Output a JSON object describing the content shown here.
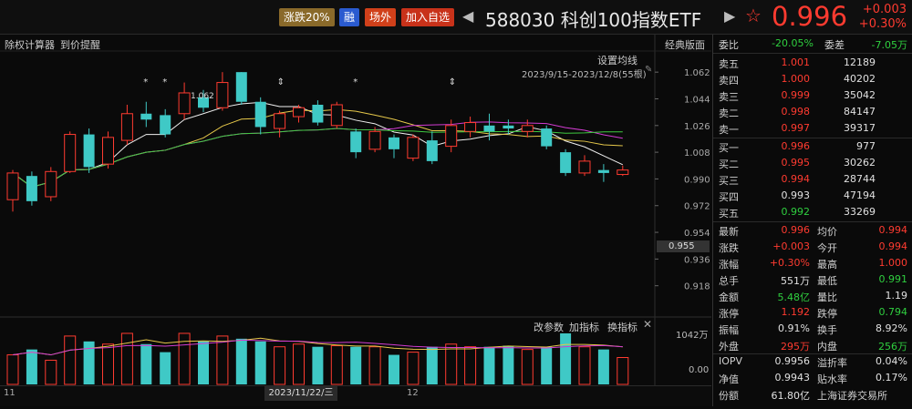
{
  "header": {
    "tag_limit": "涨跌20%",
    "tag_margin": "融",
    "tag_otc": "场外",
    "tag_watch": "加入自选",
    "title": "588030 科创100指数ETF",
    "price": "0.996",
    "change": "+0.003",
    "change_pct": "+0.30%"
  },
  "toolbar": {
    "ex_rights": "除权计算器",
    "due_remind": "到价提醒",
    "classic": "经典版面",
    "ma_setting": "设置均线",
    "range": "2023/9/15-2023/12/8(55根)",
    "vol_params": "改参数",
    "add_indicator": "加指标",
    "switch_indicator": "换指标"
  },
  "chart_data": {
    "type": "candlestick",
    "y_ticks": [
      "1.062",
      "1.044",
      "1.026",
      "1.008",
      "0.990",
      "0.972",
      "0.954",
      "0.936",
      "0.918"
    ],
    "ylim": [
      0.9,
      1.075
    ],
    "hover_price": "0.955",
    "max_label": "1.062",
    "vol_ticks": [
      "1042万",
      "0.00"
    ],
    "x_labels": [
      "11",
      "2023/11/22/三",
      "12"
    ],
    "candles": [
      {
        "o": 0.976,
        "c": 0.994,
        "h": 0.996,
        "l": 0.968
      },
      {
        "o": 0.992,
        "c": 0.975,
        "h": 0.995,
        "l": 0.972
      },
      {
        "o": 0.978,
        "c": 0.995,
        "h": 0.998,
        "l": 0.975
      },
      {
        "o": 0.995,
        "c": 1.02,
        "h": 1.022,
        "l": 0.994
      },
      {
        "o": 1.02,
        "c": 0.998,
        "h": 1.024,
        "l": 0.994
      },
      {
        "o": 1.0,
        "c": 1.018,
        "h": 1.022,
        "l": 0.997
      },
      {
        "o": 1.016,
        "c": 1.034,
        "h": 1.04,
        "l": 1.013
      },
      {
        "o": 1.034,
        "c": 1.03,
        "h": 1.042,
        "l": 1.025
      },
      {
        "o": 1.033,
        "c": 1.02,
        "h": 1.037,
        "l": 1.018
      },
      {
        "o": 1.034,
        "c": 1.048,
        "h": 1.055,
        "l": 1.03
      },
      {
        "o": 1.045,
        "c": 1.038,
        "h": 1.05,
        "l": 1.035
      },
      {
        "o": 1.038,
        "c": 1.055,
        "h": 1.062,
        "l": 1.036
      },
      {
        "o": 1.062,
        "c": 1.042,
        "h": 1.062,
        "l": 1.04
      },
      {
        "o": 1.042,
        "c": 1.025,
        "h": 1.045,
        "l": 1.02
      },
      {
        "o": 1.024,
        "c": 1.034,
        "h": 1.036,
        "l": 1.018
      },
      {
        "o": 1.032,
        "c": 1.038,
        "h": 1.04,
        "l": 1.028
      },
      {
        "o": 1.04,
        "c": 1.028,
        "h": 1.043,
        "l": 1.026
      },
      {
        "o": 1.026,
        "c": 1.04,
        "h": 1.042,
        "l": 1.024
      },
      {
        "o": 1.022,
        "c": 1.008,
        "h": 1.024,
        "l": 1.004
      },
      {
        "o": 1.01,
        "c": 1.022,
        "h": 1.025,
        "l": 1.008
      },
      {
        "o": 1.018,
        "c": 1.01,
        "h": 1.02,
        "l": 1.004
      },
      {
        "o": 1.004,
        "c": 1.018,
        "h": 1.02,
        "l": 1.002
      },
      {
        "o": 1.016,
        "c": 1.002,
        "h": 1.022,
        "l": 1.0
      },
      {
        "o": 1.012,
        "c": 1.026,
        "h": 1.03,
        "l": 1.008
      },
      {
        "o": 1.022,
        "c": 1.028,
        "h": 1.032,
        "l": 1.018
      },
      {
        "o": 1.026,
        "c": 1.022,
        "h": 1.034,
        "l": 1.016
      },
      {
        "o": 1.026,
        "c": 1.024,
        "h": 1.03,
        "l": 1.02
      },
      {
        "o": 1.022,
        "c": 1.026,
        "h": 1.03,
        "l": 1.018
      },
      {
        "o": 1.024,
        "c": 1.012,
        "h": 1.026,
        "l": 1.01
      },
      {
        "o": 1.008,
        "c": 0.994,
        "h": 1.01,
        "l": 0.992
      },
      {
        "o": 0.994,
        "c": 1.002,
        "h": 1.006,
        "l": 0.992
      },
      {
        "o": 0.996,
        "c": 0.994,
        "h": 1.0,
        "l": 0.988
      },
      {
        "o": 0.993,
        "c": 0.996,
        "h": 0.999,
        "l": 0.992
      }
    ],
    "volumes": [
      0.55,
      0.65,
      0.45,
      0.9,
      0.8,
      0.75,
      0.95,
      0.75,
      0.6,
      0.95,
      0.8,
      0.9,
      0.85,
      0.8,
      0.7,
      0.75,
      0.7,
      0.72,
      0.7,
      0.7,
      0.55,
      0.6,
      0.7,
      0.75,
      0.7,
      0.7,
      0.72,
      0.65,
      0.7,
      0.95,
      0.7,
      0.65,
      0.5
    ],
    "vol_up": [
      true,
      false,
      true,
      true,
      false,
      true,
      true,
      false,
      false,
      true,
      false,
      true,
      false,
      false,
      true,
      true,
      false,
      true,
      false,
      true,
      false,
      true,
      false,
      true,
      true,
      false,
      false,
      true,
      false,
      false,
      true,
      false,
      true
    ]
  },
  "quote": {
    "webi_label": "委比",
    "webi": "-20.05%",
    "weicha_label": "委差",
    "weicha": "-7.05万",
    "asks": [
      {
        "label": "卖五",
        "price": "1.001",
        "vol": "12189"
      },
      {
        "label": "卖四",
        "price": "1.000",
        "vol": "40202"
      },
      {
        "label": "卖三",
        "price": "0.999",
        "vol": "35042"
      },
      {
        "label": "卖二",
        "price": "0.998",
        "vol": "84147"
      },
      {
        "label": "卖一",
        "price": "0.997",
        "vol": "39317"
      }
    ],
    "bids": [
      {
        "label": "买一",
        "price": "0.996",
        "vol": "977"
      },
      {
        "label": "买二",
        "price": "0.995",
        "vol": "30262"
      },
      {
        "label": "买三",
        "price": "0.994",
        "vol": "28744"
      },
      {
        "label": "买四",
        "price": "0.993",
        "vol": "47194"
      },
      {
        "label": "买五",
        "price": "0.992",
        "vol": "33269"
      }
    ],
    "stats": [
      {
        "l1": "最新",
        "v1": "0.996",
        "c1": "red",
        "l2": "均价",
        "v2": "0.994",
        "c2": "red"
      },
      {
        "l1": "涨跌",
        "v1": "+0.003",
        "c1": "red",
        "l2": "今开",
        "v2": "0.994",
        "c2": "red"
      },
      {
        "l1": "涨幅",
        "v1": "+0.30%",
        "c1": "red",
        "l2": "最高",
        "v2": "1.000",
        "c2": "red"
      },
      {
        "l1": "总手",
        "v1": "551万",
        "c1": "white",
        "l2": "最低",
        "v2": "0.991",
        "c2": "green"
      },
      {
        "l1": "金额",
        "v1": "5.48亿",
        "c1": "green",
        "l2": "量比",
        "v2": "1.19",
        "c2": "white"
      },
      {
        "l1": "涨停",
        "v1": "1.192",
        "c1": "red",
        "l2": "跌停",
        "v2": "0.794",
        "c2": "green"
      },
      {
        "l1": "振幅",
        "v1": "0.91%",
        "c1": "white",
        "l2": "换手",
        "v2": "8.92%",
        "c2": "white"
      },
      {
        "l1": "外盘",
        "v1": "295万",
        "c1": "red",
        "l2": "内盘",
        "v2": "256万",
        "c2": "green"
      },
      {
        "l1": "IOPV",
        "v1": "0.9956",
        "c1": "white",
        "l2": "溢折率",
        "v2": "0.04%",
        "c2": "white"
      },
      {
        "l1": "净值",
        "v1": "0.9943",
        "c1": "white",
        "l2": "贴水率",
        "v2": "0.17%",
        "c2": "white"
      },
      {
        "l1": "份额",
        "v1": "61.80亿",
        "c1": "white",
        "l2": "上海证券交易所",
        "v2": "",
        "c2": "white"
      }
    ]
  }
}
